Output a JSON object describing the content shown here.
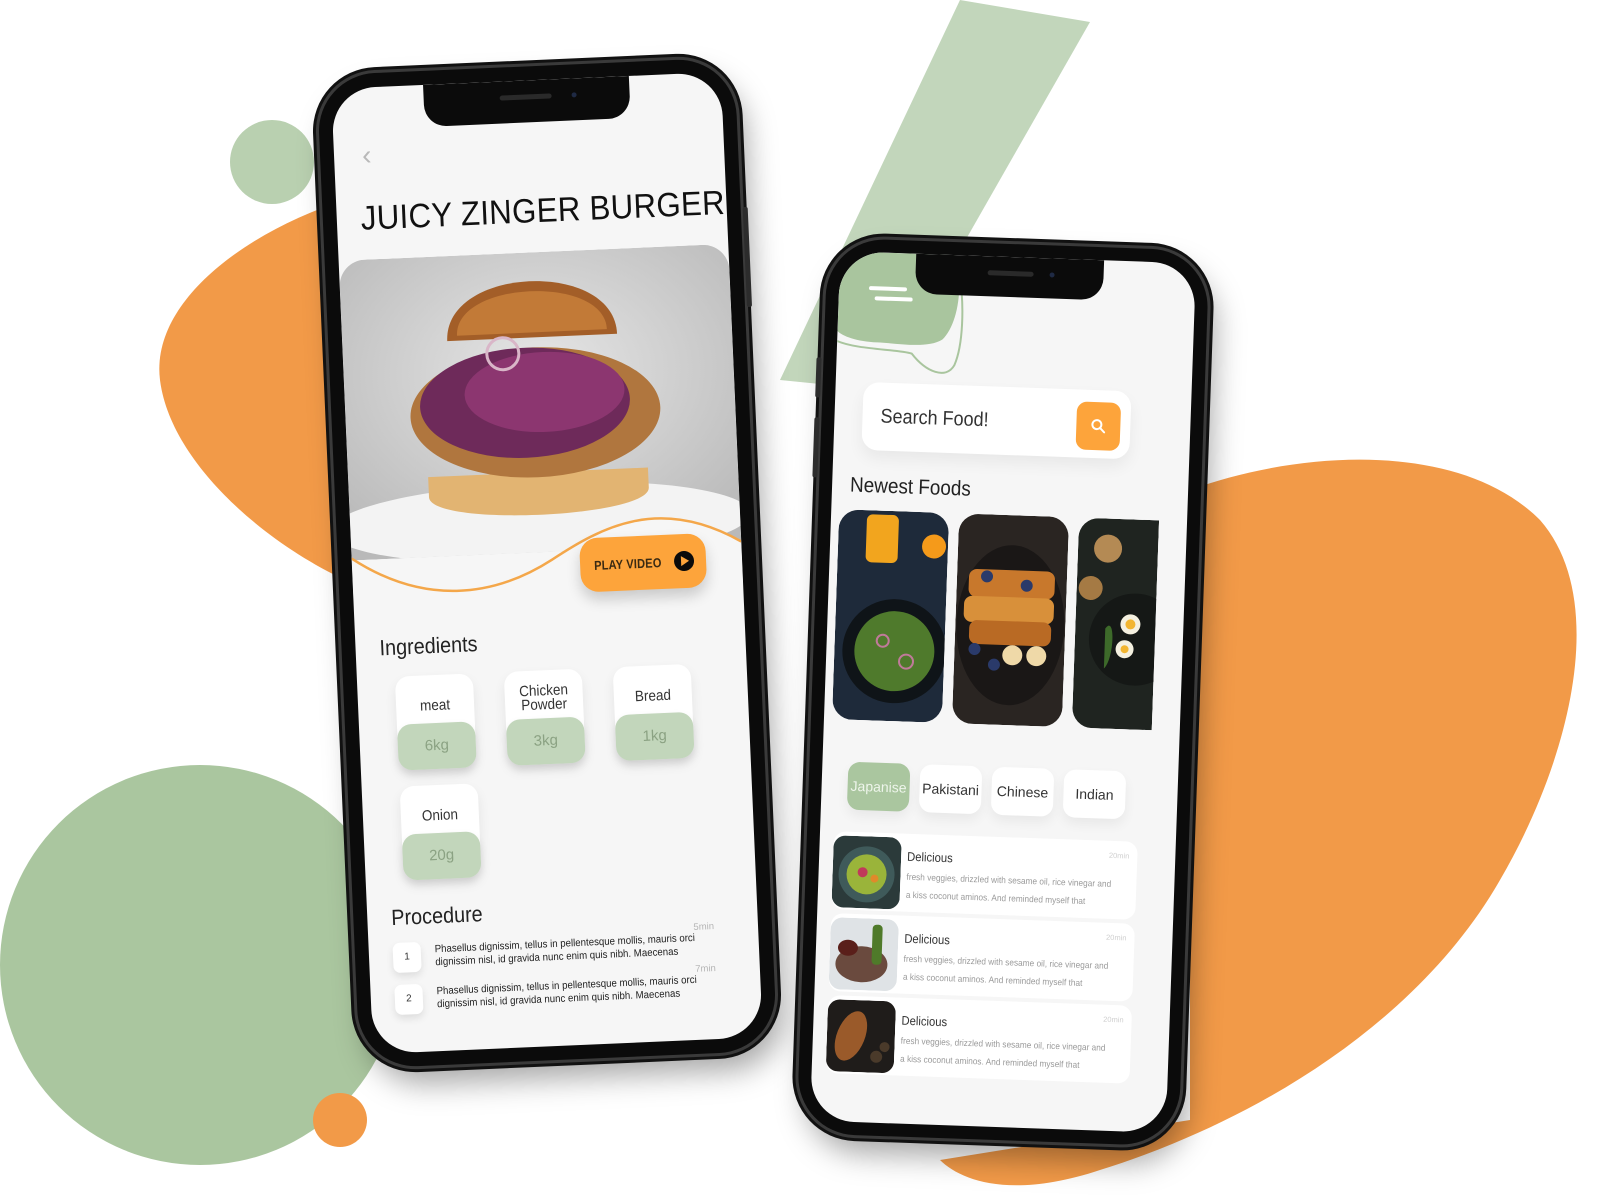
{
  "colors": {
    "orange": "#f29a48",
    "green": "#a9c59e",
    "light_green": "#c2d6bb",
    "accent_button": "#fda43b",
    "screen_bg": "#f6f6f6"
  },
  "recipe_screen": {
    "back_icon": "chevron-left-icon",
    "title": "JUICY ZINGER BURGER",
    "hero_image": "juicy zinger burger photo",
    "play_video_label": "PLAY VIDEO",
    "play_icon": "play-circle-icon",
    "ingredients_heading": "Ingredients",
    "ingredients": [
      {
        "name": "meat",
        "qty": "6kg"
      },
      {
        "name": "Chicken Powder",
        "qty": "3kg"
      },
      {
        "name": "Bread",
        "qty": "1kg"
      },
      {
        "name": "Onion",
        "qty": "20g"
      }
    ],
    "procedure_heading": "Procedure",
    "procedure": [
      {
        "step": "1",
        "time": "5min",
        "text": "Phasellus dignissim, tellus in pellentesque mollis, mauris orci dignissim nisl, id gravida nunc enim quis nibh. Maecenas"
      },
      {
        "step": "2",
        "time": "7min",
        "text": "Phasellus dignissim, tellus in pellentesque mollis, mauris orci dignissim nisl, id gravida nunc enim quis nibh. Maecenas"
      }
    ]
  },
  "home_screen": {
    "menu_icon": "hamburger-menu-icon",
    "search": {
      "placeholder": "Search Food!",
      "value": "",
      "button_icon": "search-icon"
    },
    "newest_heading": "Newest Foods",
    "newest_foods": [
      {
        "image": "salad with orange juice"
      },
      {
        "image": "french toast with blueberries and banana"
      },
      {
        "image": "egg and greens plate"
      }
    ],
    "categories": [
      {
        "label": "Japanise",
        "active": true
      },
      {
        "label": "Pakistani",
        "active": false
      },
      {
        "label": "Chinese",
        "active": false
      },
      {
        "label": "Indian",
        "active": false
      }
    ],
    "recipes": [
      {
        "title": "Delicious",
        "time": "20min",
        "desc": "fresh veggies, drizzled with sesame oil, rice vinegar and a kiss coconut aminos. And reminded myself that",
        "image": "veggie bowl"
      },
      {
        "title": "Delicious",
        "time": "20min",
        "desc": "fresh veggies, drizzled with sesame oil, rice vinegar and a kiss coconut aminos. And reminded myself that",
        "image": "steak with asparagus"
      },
      {
        "title": "Delicious",
        "time": "20min",
        "desc": "fresh veggies, drizzled with sesame oil, rice vinegar and a kiss coconut aminos. And reminded myself that",
        "image": "roasted bread"
      }
    ]
  }
}
